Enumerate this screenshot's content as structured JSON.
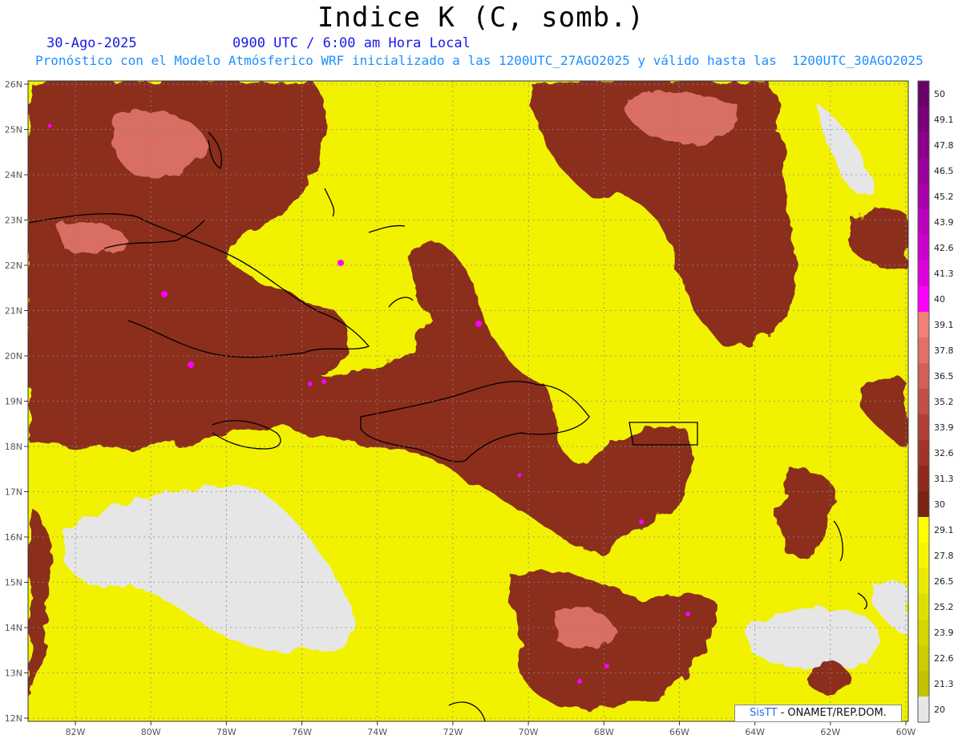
{
  "header": {
    "title": "Indice K (C, somb.)",
    "date": "30-Ago-2025",
    "time": "0900 UTC / 6:00 am Hora Local",
    "subtitle": "Pronóstico con el Modelo Atmósferico WRF inicializado a las 1200UTC_27AGO2025 y válido hasta las  1200UTC_30AGO2025"
  },
  "map": {
    "lat_labels": [
      "26N",
      "25N",
      "24N",
      "23N",
      "22N",
      "21N",
      "20N",
      "19N",
      "18N",
      "17N",
      "16N",
      "15N",
      "14N",
      "13N",
      "12N"
    ],
    "lon_labels": [
      "82W",
      "80W",
      "78W",
      "76W",
      "74W",
      "72W",
      "70W",
      "68W",
      "66W",
      "64W",
      "62W",
      "60W"
    ],
    "colors": {
      "no_data": "#e6e6e6",
      "low": "#c8c800",
      "mid_yellow": "#f2f200",
      "bright_yellow": "#ffff33",
      "dark_brown": "#8b2f1e",
      "mid_brown": "#a8453a",
      "pink_brown": "#d96e64",
      "magenta": "#ff00ff",
      "coast": "#000000"
    }
  },
  "colorbar": {
    "labels": [
      "50",
      "49.1",
      "47.8",
      "46.5",
      "45.2",
      "43.9",
      "42.6",
      "41.3",
      "40",
      "39.1",
      "37.8",
      "36.5",
      "35.2",
      "33.9",
      "32.6",
      "31.3",
      "30",
      "29.1",
      "27.8",
      "26.5",
      "25.2",
      "23.9",
      "22.6",
      "21.3",
      "20"
    ],
    "colors": [
      "#6a006a",
      "#7a007a",
      "#8a008a",
      "#9a009a",
      "#aa00aa",
      "#bb00bb",
      "#cc00cc",
      "#dd00dd",
      "#ff00ff",
      "#f08078",
      "#e07068",
      "#d06058",
      "#c05048",
      "#b04038",
      "#a03428",
      "#8e2a1c",
      "#7a2414",
      "#ffff00",
      "#f5f500",
      "#eaea00",
      "#e0e000",
      "#d6d600",
      "#cccc00",
      "#c2c200",
      "#e6e6e6"
    ]
  },
  "credit": {
    "brand": "SisTT",
    "text": " - ONAMET/REP.DOM."
  }
}
